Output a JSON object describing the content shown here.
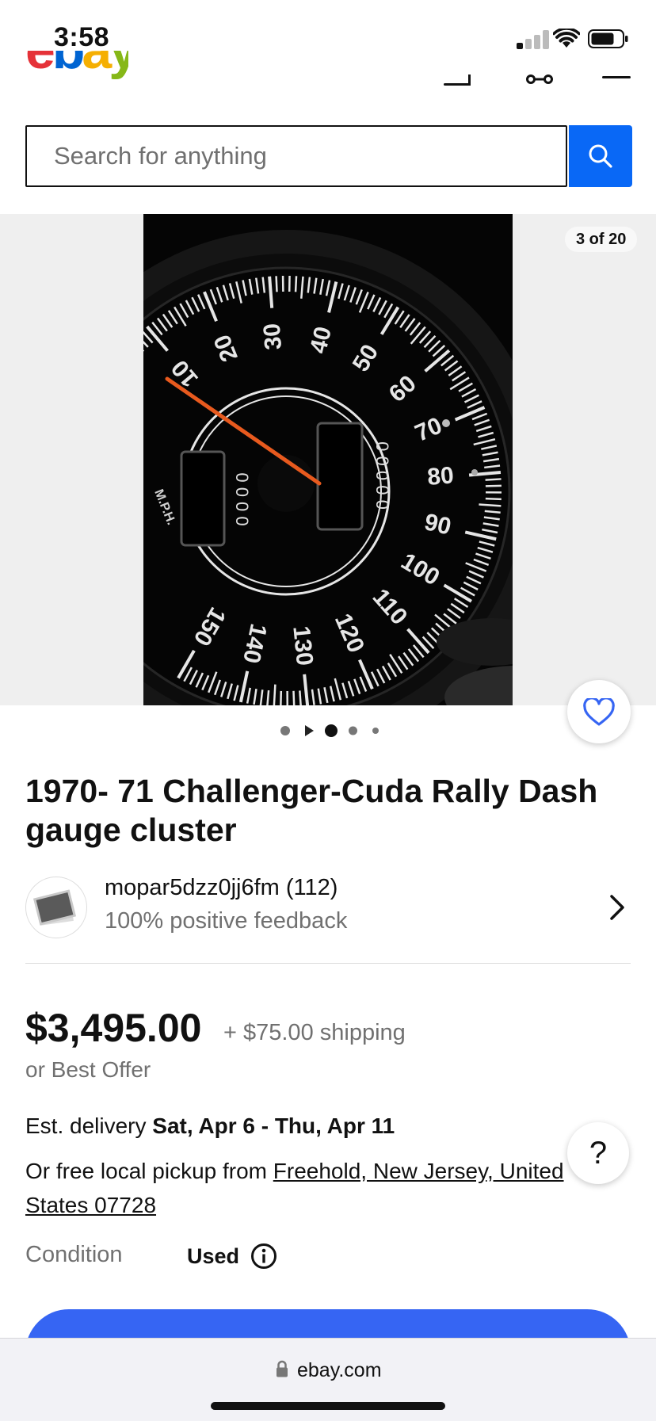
{
  "status_bar": {
    "time": "3:58"
  },
  "header": {
    "logo_text": "ebay"
  },
  "search": {
    "placeholder": "Search for anything"
  },
  "gallery": {
    "counter": "3 of 20"
  },
  "listing": {
    "title": "1970- 71 Challenger-Cuda Rally Dash gauge cluster",
    "seller_name": "mopar5dzz0jj6fm (112)",
    "seller_feedback": "100% positive feedback",
    "price": "$3,495.00",
    "shipping": "+ $75.00 shipping",
    "best_offer": "or Best Offer",
    "delivery_label": "Est. delivery ",
    "delivery_dates": "Sat, Apr 6 - Thu, Apr 11",
    "pickup_label": "Or free local pickup from ",
    "pickup_location": "Freehold, New Jersey, United States 07728",
    "condition_label": "Condition",
    "condition_value": "Used"
  },
  "help": {
    "label": "?"
  },
  "browser": {
    "url": "ebay.com"
  },
  "gauge": {
    "labels": [
      "10",
      "20",
      "30",
      "40",
      "50",
      "60",
      "70",
      "80",
      "90",
      "100",
      "110",
      "120",
      "130",
      "140",
      "150"
    ],
    "unit": "M.P.H."
  },
  "colors": {
    "accent": "#0968f6",
    "buy_button": "#3665f3",
    "logo_e": "#e53238",
    "logo_b": "#0064d2",
    "logo_a": "#f5af02",
    "logo_y": "#86b817"
  }
}
